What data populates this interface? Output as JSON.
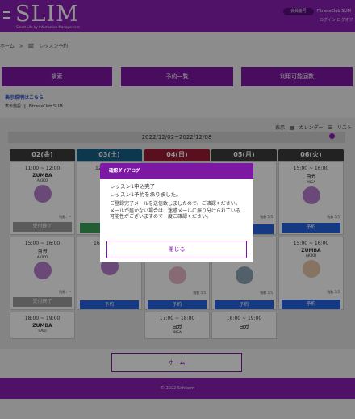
{
  "header": {
    "logo": "SLIM",
    "logo_tagline": "Smart Life by Information Management",
    "user_badge": "会員番号",
    "club_name": "FitnessClub SLIM",
    "links": "ログイン  ログオフ"
  },
  "breadcrumb": {
    "home": "ホーム",
    "sep": ">",
    "current": "レッスン予約"
  },
  "nav": {
    "search": "検索",
    "reservations": "予約一覧",
    "available": "利用可能回数"
  },
  "help_link": "表示説明はこちら",
  "store": {
    "label": "表示施設",
    "sep": "|",
    "name": "FitnessClub SLIM"
  },
  "view_tabs": {
    "display": "表示",
    "calendar": "カレンダー",
    "list": "リスト"
  },
  "date_range": "2022/12/02~2022/12/08",
  "days": [
    {
      "label": "02(金)",
      "color": "#3b3b3b"
    },
    {
      "label": "03(土)",
      "color": "#155f86"
    },
    {
      "label": "04(日)",
      "color": "#9c1b34"
    },
    {
      "label": "05(月)",
      "color": "#3b3b3b"
    },
    {
      "label": "06(火)",
      "color": "#3b3b3b"
    }
  ],
  "lessons": {
    "d1a": {
      "time": "11:00 ~ 12:00",
      "name": "ZUMBA",
      "instructor": "AKIKO",
      "seats": "残数：--",
      "button": "受付終了"
    },
    "d1b": {
      "time": "15:00 ~ 16:00",
      "name": "ヨガ",
      "instructor": "AKIKO",
      "seats": "残数：--",
      "button": "受付終了"
    },
    "d1c": {
      "time": "18:00 ~ 19:00",
      "name": "ZUMBA",
      "instructor": "SAKI"
    },
    "d2a": {
      "time": "12",
      "button": ""
    },
    "d2b": {
      "time": "16",
      "button": "予約"
    },
    "d3b": {
      "seats": "残数 5/5",
      "button": "予約"
    },
    "d3c": {
      "time": "17:00 ~ 18:00",
      "name": "ヨガ",
      "instructor": "MISA"
    },
    "d4a": {
      "seats": "残数 5/5",
      "button": "予約"
    },
    "d4b": {
      "seats": "残数 5/5",
      "button": "予約"
    },
    "d4c": {
      "time": "18:00 ~ 19:00",
      "name": "ヨガ"
    },
    "d5a": {
      "time": "15:00 ~ 16:00",
      "name": "ヨガ",
      "instructor": "MISA",
      "seats": "残数 5/5",
      "button": "予約"
    },
    "d5b": {
      "time": "15:00 ~ 16:00",
      "name": "ZUMBA",
      "instructor": "AKIKO",
      "seats": "残数 5/5",
      "button": "予約"
    }
  },
  "home_button": "ホーム",
  "footer": "© 2022 Sohfarm",
  "modal": {
    "title": "確認ダイアログ",
    "line1": "レッスン1申込完了",
    "line2": "レッスン1予約を承りました。",
    "line3": "ご登録完了メールを送信致しましたので、ご確認ください。",
    "line4": "メールが届かない場合は、迷惑メールに振り分けられている可能性がございますので一度ご確認ください。",
    "close": "閉じる"
  }
}
